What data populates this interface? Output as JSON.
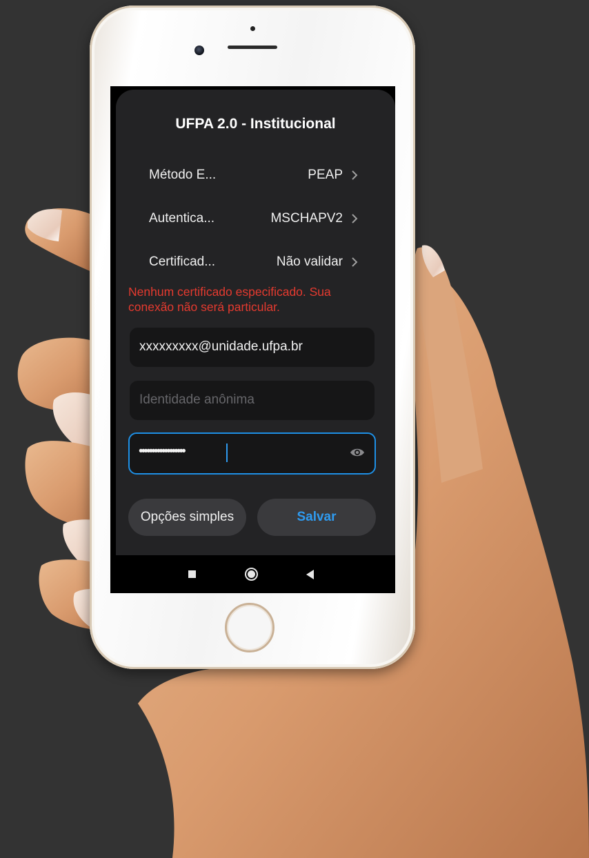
{
  "dialog": {
    "title": "UFPA 2.0 - Institucional",
    "rows": [
      {
        "label": "Método E...",
        "value": "PEAP"
      },
      {
        "label": "Autentica...",
        "value": "MSCHAPV2"
      },
      {
        "label": "Certificad...",
        "value": "Não validar"
      }
    ],
    "warning": "Nenhum certificado especificado. Sua conexão não será particular.",
    "identity_value": "xxxxxxxxx@unidade.ufpa.br",
    "anonymous_placeholder": "Identidade anônima",
    "password_mask": "••••••••••••••••••",
    "buttons": {
      "simple_options": "Opções simples",
      "save": "Salvar"
    }
  },
  "navbar": {
    "icons": [
      "recents-square-icon",
      "home-circle-icon",
      "back-triangle-icon"
    ]
  },
  "colors": {
    "background": "#333333",
    "dialog": "#232325",
    "warning": "#e53a2f",
    "accent": "#2f9bf0",
    "field": "#161617"
  }
}
